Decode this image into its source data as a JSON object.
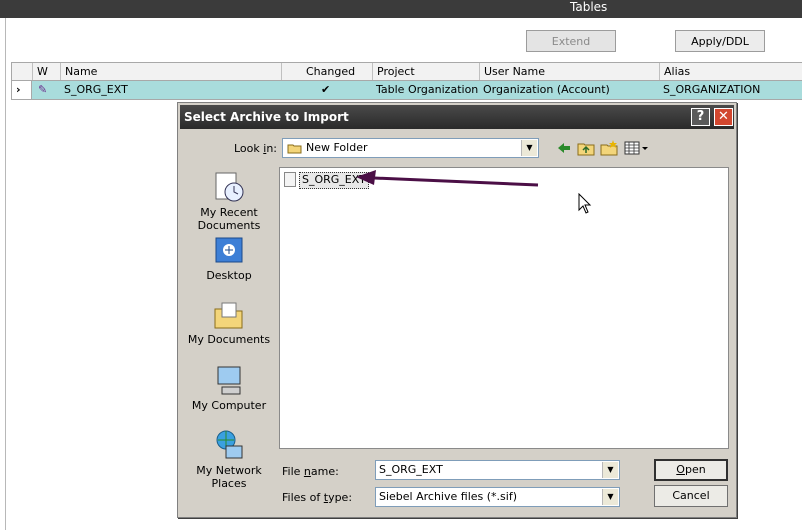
{
  "app": {
    "title": "Tables"
  },
  "toolbar": {
    "extend_label": "Extend",
    "apply_ddl_label": "Apply/DDL"
  },
  "grid": {
    "columns": [
      "W",
      "Name",
      "Changed",
      "Project",
      "User Name",
      "Alias"
    ],
    "rows": [
      {
        "w": "✎",
        "name": "S_ORG_EXT",
        "changed": "✔",
        "project": "Table Organization",
        "user_name": "Organization (Account)",
        "alias": "S_ORGANIZATION"
      }
    ]
  },
  "dialog": {
    "title": "Select Archive to Import",
    "look_in_label_pre": "Look ",
    "look_in_label_u": "i",
    "look_in_label_post": "n:",
    "look_in_value": "New Folder",
    "places": [
      "My Recent Documents",
      "Desktop",
      "My Documents",
      "My Computer",
      "My Network Places"
    ],
    "files": [
      "S_ORG_EXT"
    ],
    "file_name_label_pre": "File ",
    "file_name_label_u": "n",
    "file_name_label_post": "ame:",
    "file_name_value": "S_ORG_EXT",
    "files_of_type_label_pre": "Files of ",
    "files_of_type_label_u": "t",
    "files_of_type_label_post": "ype:",
    "files_of_type_value": "Siebel Archive files (*.sif)",
    "open_label_u": "O",
    "open_label_post": "pen",
    "cancel_label": "Cancel",
    "help_glyph": "?",
    "close_glyph": "✕"
  },
  "colors": {
    "selected_row": "#a9dcdc",
    "annotation_arrow": "#4b0f46",
    "close_button": "#d2472f"
  }
}
